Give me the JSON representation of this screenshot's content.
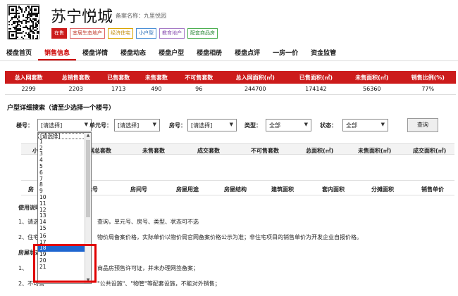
{
  "header": {
    "title": "苏宁悦城",
    "record_name": "备案名称：九里悦园",
    "tags": [
      {
        "label": "在售",
        "bg": "#cc1b1b",
        "color": "#ffffff",
        "border": "#cc1b1b"
      },
      {
        "label": "宜居生态地产",
        "bg": "#ffffff",
        "color": "#c0392b",
        "border": "#d66"
      },
      {
        "label": "经济住宅",
        "bg": "#ffffff",
        "color": "#c08a00",
        "border": "#d9a400"
      },
      {
        "label": "小户型",
        "bg": "#ffffff",
        "color": "#2a6fb8",
        "border": "#4a8fd6"
      },
      {
        "label": "教育地产",
        "bg": "#ffffff",
        "color": "#8a4fb0",
        "border": "#a57ac6"
      },
      {
        "label": "配套商品房",
        "bg": "#ffffff",
        "color": "#2e8b3a",
        "border": "#4caf50"
      }
    ]
  },
  "nav": [
    "楼盘首页",
    "销售信息",
    "楼盘详情",
    "楼盘动态",
    "楼盘户型",
    "楼盘相册",
    "楼盘点评",
    "一房一价",
    "资金监管"
  ],
  "stats": {
    "headers": [
      "总入网套数",
      "总销售套数",
      "已售套数",
      "未售套数",
      "不可售套数",
      "总入网面积(㎡)",
      "已售面积(㎡)",
      "未售面积(㎡)",
      "销售比例(%)"
    ],
    "values": [
      "2299",
      "2203",
      "1713",
      "490",
      "96",
      "244700",
      "174142",
      "56360",
      "77%"
    ]
  },
  "search_title": "户型详细搜索（请至少选择一个楼号）",
  "filters": {
    "building_label": "楼号：",
    "building_value": "[请选择]",
    "unit_label": "单元号：",
    "unit_value": "[请选择]",
    "room_label": "房号：",
    "room_value": "[请选择]",
    "type_label": "类型：",
    "type_value": "全部",
    "status_label": "状态：",
    "status_value": "全部",
    "query_button": "查询"
  },
  "table1_headers": [
    "小",
    "入网总套数",
    "未售套数",
    "成交套数",
    "不可售套数",
    "总面积(㎡)",
    "未售面积(㎡)",
    "成交面积(㎡)"
  ],
  "table2_headers": [
    "房",
    "单元号",
    "房间号",
    "房屋用途",
    "房屋结构",
    "建筑面积",
    "套内面积",
    "分摊面积",
    "销售单价"
  ],
  "notes": {
    "usage_title": "使用说明",
    "line1a": "1、请选",
    "line1b": "查询，单元号、房号、类型、状态可不选",
    "line2a": "2、住宅",
    "line2b": "物价局备案价格，实际单价以物价局官网备案价格公示为准；非住宅项目的销售单价为开发企业自报价格。",
    "status_title": "房屋状态",
    "line3a": "1、",
    "line3b": "商品房预售许可证，并未办理网签备案；",
    "line4a": "2、不可售",
    "line4b": "\"公共设施\"、\"物管\"等配套设施，不能对外销售；"
  },
  "dropdown": {
    "options": [
      "[请选择]",
      "1",
      "2",
      "3",
      "4",
      "5",
      "6",
      "7",
      "8",
      "9",
      "10",
      "11",
      "12",
      "13",
      "14",
      "15",
      "16",
      "17",
      "18",
      "19",
      "20",
      "21"
    ],
    "selected": "18"
  }
}
